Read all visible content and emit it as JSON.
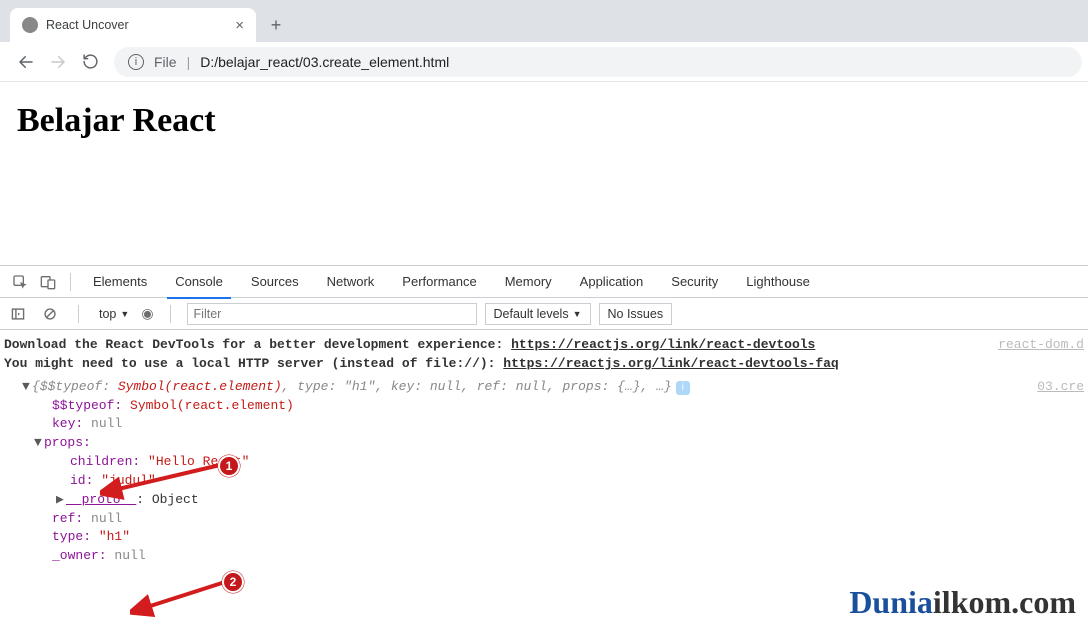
{
  "chrome": {
    "tab_title": "React Uncover",
    "address_label_file": "File",
    "address_path": "D:/belajar_react/03.create_element.html"
  },
  "page": {
    "heading": "Belajar React"
  },
  "devtools": {
    "tabs": [
      "Elements",
      "Console",
      "Sources",
      "Network",
      "Performance",
      "Memory",
      "Application",
      "Security",
      "Lighthouse"
    ],
    "active_tab": "Console",
    "context_label": "top",
    "filter_placeholder": "Filter",
    "levels_label": "Default levels",
    "no_issues_label": "No Issues"
  },
  "console_messages": {
    "line1": {
      "prefix": "Download the React DevTools for a better development experience: ",
      "link": "https://reactjs.org/link/react-devtools",
      "source": "react-dom.d"
    },
    "line2": {
      "prefix": "You might need to use a local HTTP server (instead of file://): ",
      "link": "https://reactjs.org/link/react-devtools-faq"
    }
  },
  "object_tree": {
    "summary_left": "{$$typeof: ",
    "summary_sym": "Symbol(react.element)",
    "summary_rest": ", type: \"h1\", key: null, ref: null, props: {…}, …}",
    "summary_src": "03.cre",
    "l1_typeof_key": "$$typeof:",
    "l1_typeof_val": "Symbol(react.element)",
    "l1_key": "key:",
    "l1_key_val": "null",
    "l1_props_key": "props:",
    "props_children_key": "children:",
    "props_children_val": "\"Hello React\"",
    "props_id_key": "id:",
    "props_id_val": "\"judul\"",
    "props_proto_key": "__proto__",
    "props_proto_val": ": Object",
    "l1_ref_key": "ref:",
    "l1_ref_val": "null",
    "l1_type_key": "type:",
    "l1_type_val": "\"h1\"",
    "l1_owner_key": "_owner:",
    "l1_owner_val": "null"
  },
  "annotations": {
    "one": "1",
    "two": "2"
  },
  "watermark": {
    "a": "Dunia",
    "b": "ilkom.com"
  }
}
